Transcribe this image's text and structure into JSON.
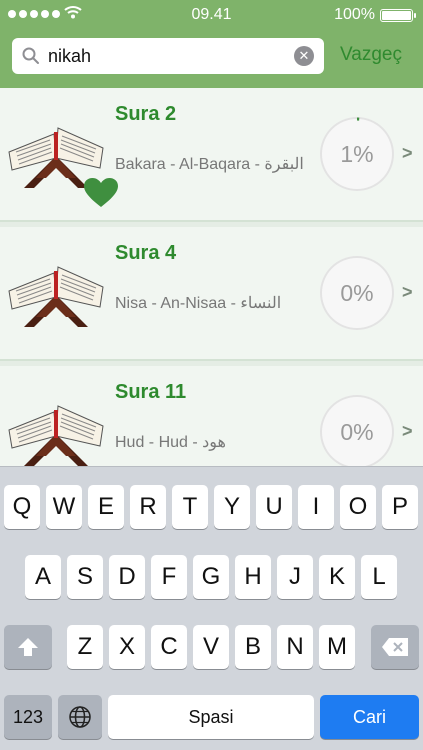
{
  "status_bar": {
    "time": "09.41",
    "battery": "100%"
  },
  "search": {
    "value": "nikah",
    "cancel_label": "Vazgeç"
  },
  "rows": [
    {
      "title": "Sura 2",
      "subtitle": "Bakara - Al-Baqara - البقرة",
      "progress": "1%",
      "progress_value": 1,
      "favorite": true
    },
    {
      "title": "Sura 4",
      "subtitle": "Nisa - An-Nisaa - النساء",
      "progress": "0%",
      "progress_value": 0,
      "favorite": false
    },
    {
      "title": "Sura 11",
      "subtitle": "Hud - Hud - هود",
      "progress": "0%",
      "progress_value": 0,
      "favorite": false
    }
  ],
  "keyboard": {
    "row1": [
      "Q",
      "W",
      "E",
      "R",
      "T",
      "Y",
      "U",
      "I",
      "O",
      "P"
    ],
    "row2": [
      "A",
      "S",
      "D",
      "F",
      "G",
      "H",
      "J",
      "K",
      "L"
    ],
    "row3": [
      "Z",
      "X",
      "C",
      "V",
      "B",
      "N",
      "M"
    ],
    "numbers_label": "123",
    "space_label": "Spasi",
    "return_label": "Cari"
  },
  "colors": {
    "header": "#7fb36a",
    "accent": "#2e8a2e",
    "heart": "#3f8f3f",
    "return_key": "#1e7cf2"
  }
}
